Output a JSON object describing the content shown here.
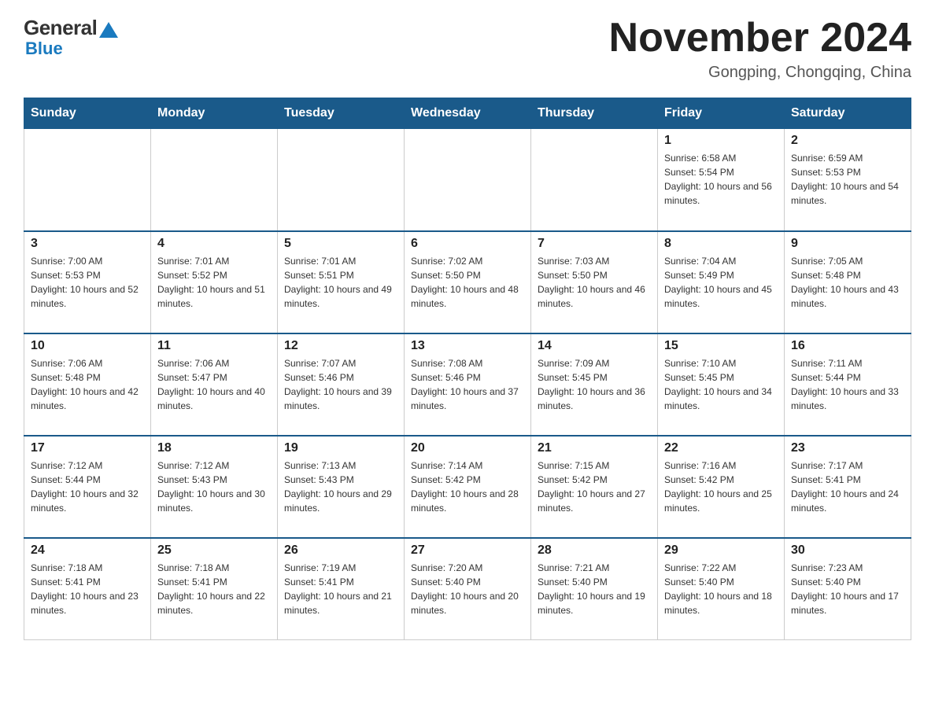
{
  "header": {
    "logo_general": "General",
    "logo_blue": "Blue",
    "month_title": "November 2024",
    "location": "Gongping, Chongqing, China"
  },
  "weekdays": [
    "Sunday",
    "Monday",
    "Tuesday",
    "Wednesday",
    "Thursday",
    "Friday",
    "Saturday"
  ],
  "weeks": [
    [
      {
        "day": "",
        "info": ""
      },
      {
        "day": "",
        "info": ""
      },
      {
        "day": "",
        "info": ""
      },
      {
        "day": "",
        "info": ""
      },
      {
        "day": "",
        "info": ""
      },
      {
        "day": "1",
        "info": "Sunrise: 6:58 AM\nSunset: 5:54 PM\nDaylight: 10 hours and 56 minutes."
      },
      {
        "day": "2",
        "info": "Sunrise: 6:59 AM\nSunset: 5:53 PM\nDaylight: 10 hours and 54 minutes."
      }
    ],
    [
      {
        "day": "3",
        "info": "Sunrise: 7:00 AM\nSunset: 5:53 PM\nDaylight: 10 hours and 52 minutes."
      },
      {
        "day": "4",
        "info": "Sunrise: 7:01 AM\nSunset: 5:52 PM\nDaylight: 10 hours and 51 minutes."
      },
      {
        "day": "5",
        "info": "Sunrise: 7:01 AM\nSunset: 5:51 PM\nDaylight: 10 hours and 49 minutes."
      },
      {
        "day": "6",
        "info": "Sunrise: 7:02 AM\nSunset: 5:50 PM\nDaylight: 10 hours and 48 minutes."
      },
      {
        "day": "7",
        "info": "Sunrise: 7:03 AM\nSunset: 5:50 PM\nDaylight: 10 hours and 46 minutes."
      },
      {
        "day": "8",
        "info": "Sunrise: 7:04 AM\nSunset: 5:49 PM\nDaylight: 10 hours and 45 minutes."
      },
      {
        "day": "9",
        "info": "Sunrise: 7:05 AM\nSunset: 5:48 PM\nDaylight: 10 hours and 43 minutes."
      }
    ],
    [
      {
        "day": "10",
        "info": "Sunrise: 7:06 AM\nSunset: 5:48 PM\nDaylight: 10 hours and 42 minutes."
      },
      {
        "day": "11",
        "info": "Sunrise: 7:06 AM\nSunset: 5:47 PM\nDaylight: 10 hours and 40 minutes."
      },
      {
        "day": "12",
        "info": "Sunrise: 7:07 AM\nSunset: 5:46 PM\nDaylight: 10 hours and 39 minutes."
      },
      {
        "day": "13",
        "info": "Sunrise: 7:08 AM\nSunset: 5:46 PM\nDaylight: 10 hours and 37 minutes."
      },
      {
        "day": "14",
        "info": "Sunrise: 7:09 AM\nSunset: 5:45 PM\nDaylight: 10 hours and 36 minutes."
      },
      {
        "day": "15",
        "info": "Sunrise: 7:10 AM\nSunset: 5:45 PM\nDaylight: 10 hours and 34 minutes."
      },
      {
        "day": "16",
        "info": "Sunrise: 7:11 AM\nSunset: 5:44 PM\nDaylight: 10 hours and 33 minutes."
      }
    ],
    [
      {
        "day": "17",
        "info": "Sunrise: 7:12 AM\nSunset: 5:44 PM\nDaylight: 10 hours and 32 minutes."
      },
      {
        "day": "18",
        "info": "Sunrise: 7:12 AM\nSunset: 5:43 PM\nDaylight: 10 hours and 30 minutes."
      },
      {
        "day": "19",
        "info": "Sunrise: 7:13 AM\nSunset: 5:43 PM\nDaylight: 10 hours and 29 minutes."
      },
      {
        "day": "20",
        "info": "Sunrise: 7:14 AM\nSunset: 5:42 PM\nDaylight: 10 hours and 28 minutes."
      },
      {
        "day": "21",
        "info": "Sunrise: 7:15 AM\nSunset: 5:42 PM\nDaylight: 10 hours and 27 minutes."
      },
      {
        "day": "22",
        "info": "Sunrise: 7:16 AM\nSunset: 5:42 PM\nDaylight: 10 hours and 25 minutes."
      },
      {
        "day": "23",
        "info": "Sunrise: 7:17 AM\nSunset: 5:41 PM\nDaylight: 10 hours and 24 minutes."
      }
    ],
    [
      {
        "day": "24",
        "info": "Sunrise: 7:18 AM\nSunset: 5:41 PM\nDaylight: 10 hours and 23 minutes."
      },
      {
        "day": "25",
        "info": "Sunrise: 7:18 AM\nSunset: 5:41 PM\nDaylight: 10 hours and 22 minutes."
      },
      {
        "day": "26",
        "info": "Sunrise: 7:19 AM\nSunset: 5:41 PM\nDaylight: 10 hours and 21 minutes."
      },
      {
        "day": "27",
        "info": "Sunrise: 7:20 AM\nSunset: 5:40 PM\nDaylight: 10 hours and 20 minutes."
      },
      {
        "day": "28",
        "info": "Sunrise: 7:21 AM\nSunset: 5:40 PM\nDaylight: 10 hours and 19 minutes."
      },
      {
        "day": "29",
        "info": "Sunrise: 7:22 AM\nSunset: 5:40 PM\nDaylight: 10 hours and 18 minutes."
      },
      {
        "day": "30",
        "info": "Sunrise: 7:23 AM\nSunset: 5:40 PM\nDaylight: 10 hours and 17 minutes."
      }
    ]
  ]
}
